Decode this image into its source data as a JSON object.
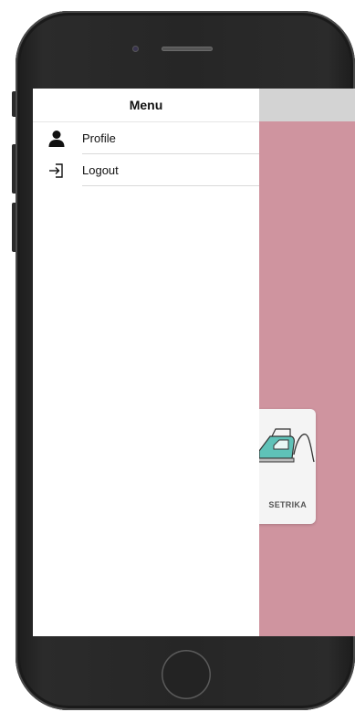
{
  "drawer": {
    "title": "Menu",
    "items": [
      {
        "label": "Profile",
        "icon": "person-icon"
      },
      {
        "label": "Logout",
        "icon": "logout-icon"
      }
    ]
  },
  "background_app": {
    "service_card": {
      "label": "SETRIKA",
      "icon": "iron-icon"
    }
  },
  "colors": {
    "app_background": "#cf949f",
    "app_header": "#d3d3d3",
    "drawer_background": "#ffffff",
    "phone_body": "#262626",
    "iron_accent": "#5fc2b8"
  }
}
